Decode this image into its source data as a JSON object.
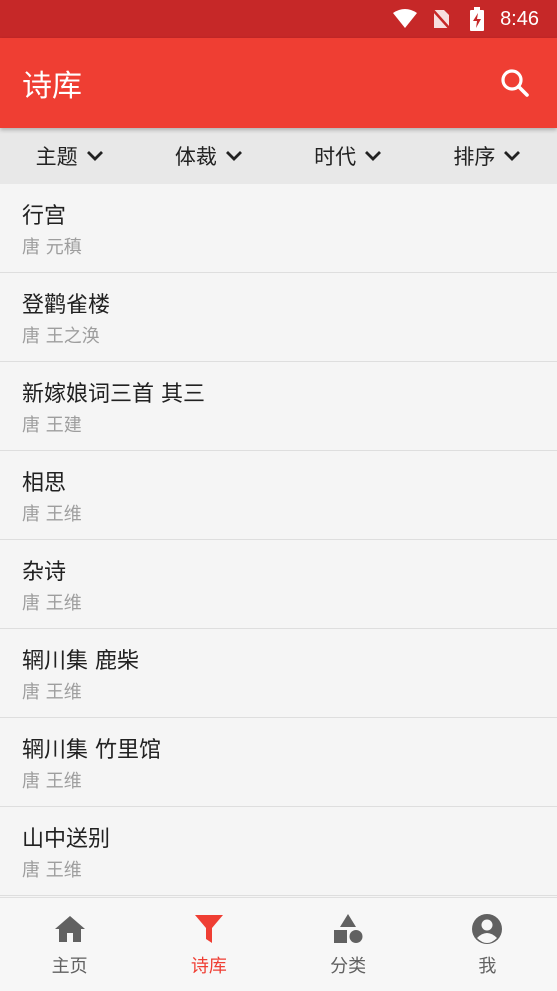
{
  "status_bar": {
    "time": "8:46"
  },
  "app_bar": {
    "title": "诗库"
  },
  "filters": [
    {
      "label": "主题"
    },
    {
      "label": "体裁"
    },
    {
      "label": "时代"
    },
    {
      "label": "排序"
    }
  ],
  "poems": [
    {
      "title": "行宫",
      "meta": "唐 元稹"
    },
    {
      "title": "登鹳雀楼",
      "meta": "唐 王之涣"
    },
    {
      "title": "新嫁娘词三首 其三",
      "meta": "唐 王建"
    },
    {
      "title": "相思",
      "meta": "唐 王维"
    },
    {
      "title": "杂诗",
      "meta": "唐 王维"
    },
    {
      "title": "辋川集 鹿柴",
      "meta": "唐 王维"
    },
    {
      "title": "辋川集 竹里馆",
      "meta": "唐 王维"
    },
    {
      "title": "山中送别",
      "meta": "唐 王维"
    }
  ],
  "bottom_nav": [
    {
      "label": "主页",
      "icon": "home-icon"
    },
    {
      "label": "诗库",
      "icon": "filter-icon",
      "active": true
    },
    {
      "label": "分类",
      "icon": "shapes-icon"
    },
    {
      "label": "我",
      "icon": "account-icon"
    }
  ],
  "colors": {
    "primary": "#ef3e33",
    "status_bar": "#c62828"
  }
}
